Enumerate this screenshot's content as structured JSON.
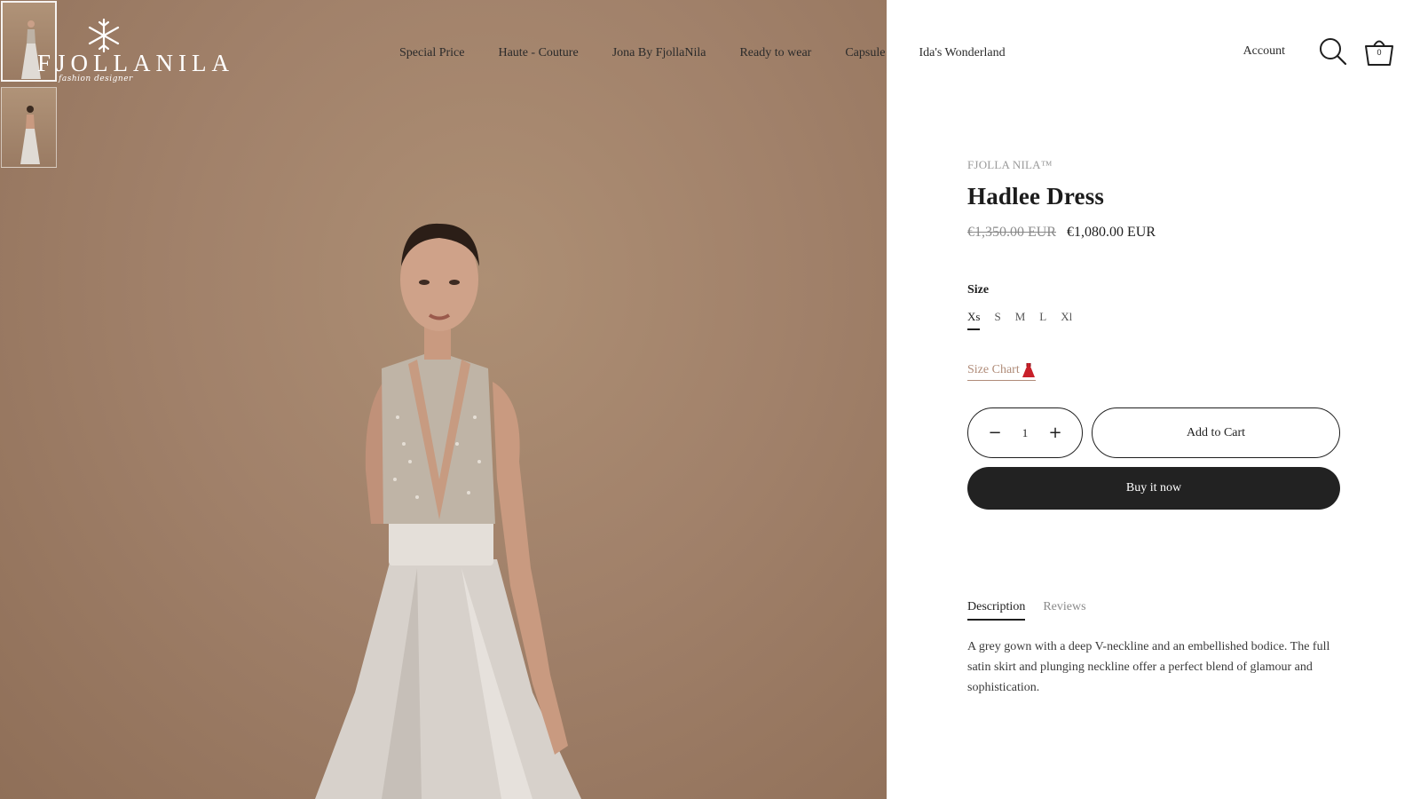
{
  "logo": {
    "wordmark": "FJOLLANILA",
    "tagline": "fashion designer"
  },
  "thumbnails": [
    {
      "label": "Hadlee Dress front view",
      "active": true
    },
    {
      "label": "Hadlee Dress back view",
      "active": false
    }
  ],
  "nav": {
    "items": [
      {
        "label": "Special Price"
      },
      {
        "label": "Haute - Couture"
      },
      {
        "label": "Jona By FjollaNila"
      },
      {
        "label": "Ready to wear"
      },
      {
        "label": "Capsule"
      },
      {
        "label": "Ida's Wonderland"
      }
    ]
  },
  "header": {
    "account_label": "Account",
    "search_icon": "search-icon",
    "cart_icon": "basket-icon",
    "cart_count": "0"
  },
  "product": {
    "vendor": "FJOLLA NILA™",
    "title": "Hadlee Dress",
    "price_compare": "€1,350.00 EUR",
    "price": "€1,080.00 EUR",
    "size_label": "Size",
    "sizes": [
      "Xs",
      "S",
      "M",
      "L",
      "Xl"
    ],
    "selected_size": "Xs",
    "size_chart_label": "Size Chart",
    "size_chart_icon": "red-dress-emoji",
    "quantity": "1",
    "add_to_cart_label": "Add to Cart",
    "buy_now_label": "Buy it now"
  },
  "tabs": {
    "items": [
      {
        "label": "Description",
        "active": true
      },
      {
        "label": "Reviews",
        "active": false
      }
    ],
    "description": "A grey gown with a deep V-neckline and an embellished bodice. The full satin skirt and plunging neckline offer a perfect blend of glamour and sophistication."
  },
  "colors": {
    "backdrop": "#a1816a",
    "buy_button": "#222222",
    "size_chart_link": "#b08c79"
  }
}
